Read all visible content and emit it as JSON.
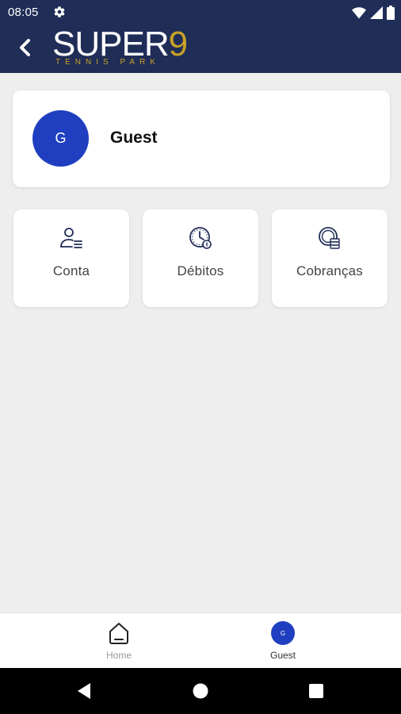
{
  "status_bar": {
    "time": "08:05",
    "icons": [
      "settings-gear-icon",
      "wifi-icon",
      "signal-icon",
      "battery-icon"
    ]
  },
  "header": {
    "back_icon": "chevron-left-icon",
    "logo": {
      "main": "SUPER",
      "digit": "9",
      "sub": "TENNIS PARK"
    },
    "colors": {
      "background": "#1f2d57",
      "logo_accent": "#c9a227"
    }
  },
  "profile": {
    "avatar_letter": "G",
    "name": "Guest",
    "avatar_color": "#1f3fc0"
  },
  "tiles": [
    {
      "label": "Conta",
      "icon": "user-list-icon"
    },
    {
      "label": "Débitos",
      "icon": "clock-coin-icon"
    },
    {
      "label": "Cobranças",
      "icon": "coins-stack-icon"
    }
  ],
  "bottom_nav": {
    "items": [
      {
        "label": "Home",
        "icon": "home-icon",
        "active": false
      },
      {
        "label": "Guest",
        "icon": "avatar",
        "avatar_letter": "G",
        "active": true
      }
    ]
  },
  "system_nav": {
    "icons": [
      "back-triangle-icon",
      "home-circle-icon",
      "recents-square-icon"
    ]
  }
}
